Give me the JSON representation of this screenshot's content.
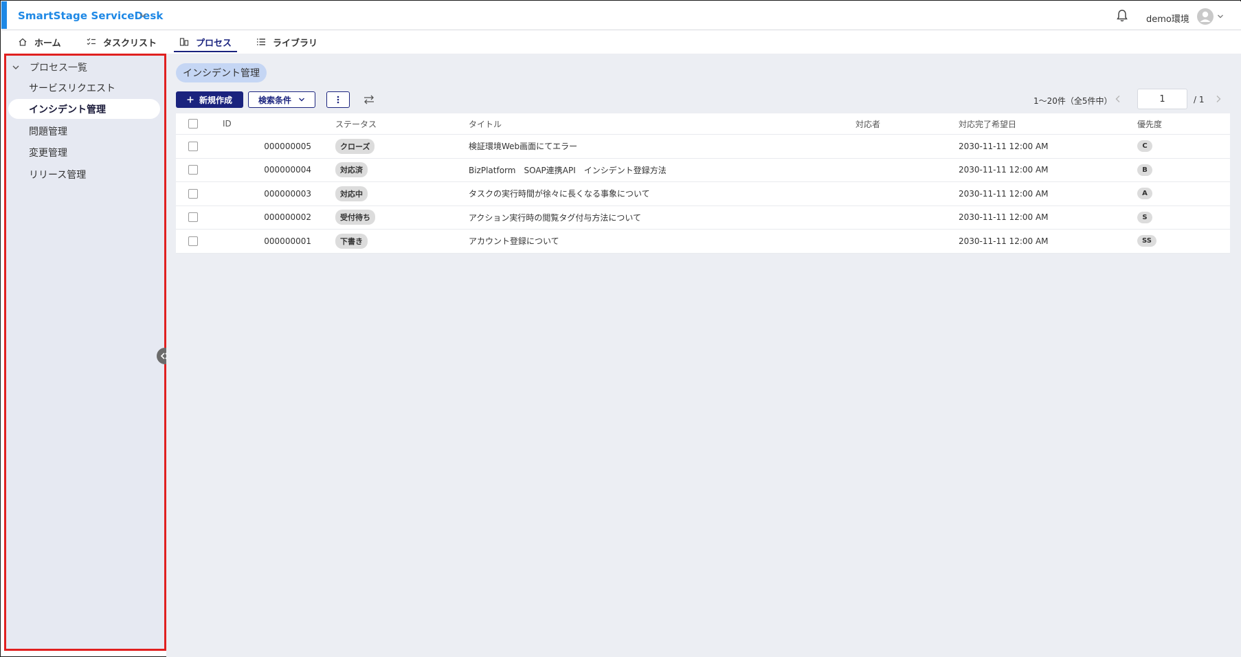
{
  "header": {
    "app_title": "SmartStage ServiceDesk",
    "env_label": "demo環境"
  },
  "nav": {
    "tabs": [
      {
        "label": "ホーム",
        "icon": "home-icon"
      },
      {
        "label": "タスクリスト",
        "icon": "checklist-icon"
      },
      {
        "label": "プロセス",
        "icon": "process-icon",
        "active": true
      },
      {
        "label": "ライブラリ",
        "icon": "list-icon"
      }
    ]
  },
  "sidebar": {
    "root_label": "プロセス一覧",
    "items": [
      {
        "label": "サービスリクエスト"
      },
      {
        "label": "インシデント管理",
        "active": true
      },
      {
        "label": "問題管理"
      },
      {
        "label": "変更管理"
      },
      {
        "label": "リリース管理"
      }
    ]
  },
  "main": {
    "breadcrumb": "インシデント管理",
    "toolbar": {
      "new_label": "新規作成",
      "search_label": "検索条件"
    },
    "pager": {
      "count_text": "1〜20件（全5件中）",
      "page_value": "1",
      "total_text": "/ 1"
    },
    "table": {
      "headers": {
        "id": "ID",
        "status": "ステータス",
        "title": "タイトル",
        "assignee": "対応者",
        "due": "対応完了希望日",
        "priority": "優先度"
      },
      "rows": [
        {
          "id": "000000005",
          "status": "クローズ",
          "title": "検証環境Web画面にてエラー",
          "assignee": "",
          "due": "2030-11-11 12:00 AM",
          "priority": "C"
        },
        {
          "id": "000000004",
          "status": "対応済",
          "title": "BizPlatform　SOAP連携API　インシデント登録方法",
          "assignee": "",
          "due": "2030-11-11 12:00 AM",
          "priority": "B"
        },
        {
          "id": "000000003",
          "status": "対応中",
          "title": "タスクの実行時間が徐々に長くなる事象について",
          "assignee": "",
          "due": "2030-11-11 12:00 AM",
          "priority": "A"
        },
        {
          "id": "000000002",
          "status": "受付待ち",
          "title": "アクション実行時の閲覧タグ付与方法について",
          "assignee": "",
          "due": "2030-11-11 12:00 AM",
          "priority": "S"
        },
        {
          "id": "000000001",
          "status": "下書き",
          "title": "アカウント登録について",
          "assignee": "",
          "due": "2030-11-11 12:00 AM",
          "priority": "SS"
        }
      ]
    }
  },
  "colors": {
    "brand": "#1e88e5",
    "primary": "#1a237e",
    "highlight_border": "#e02020",
    "sidebar_bg": "#e6e9f2",
    "main_bg": "#eceef3",
    "chip_bg": "#c5d6f4"
  }
}
